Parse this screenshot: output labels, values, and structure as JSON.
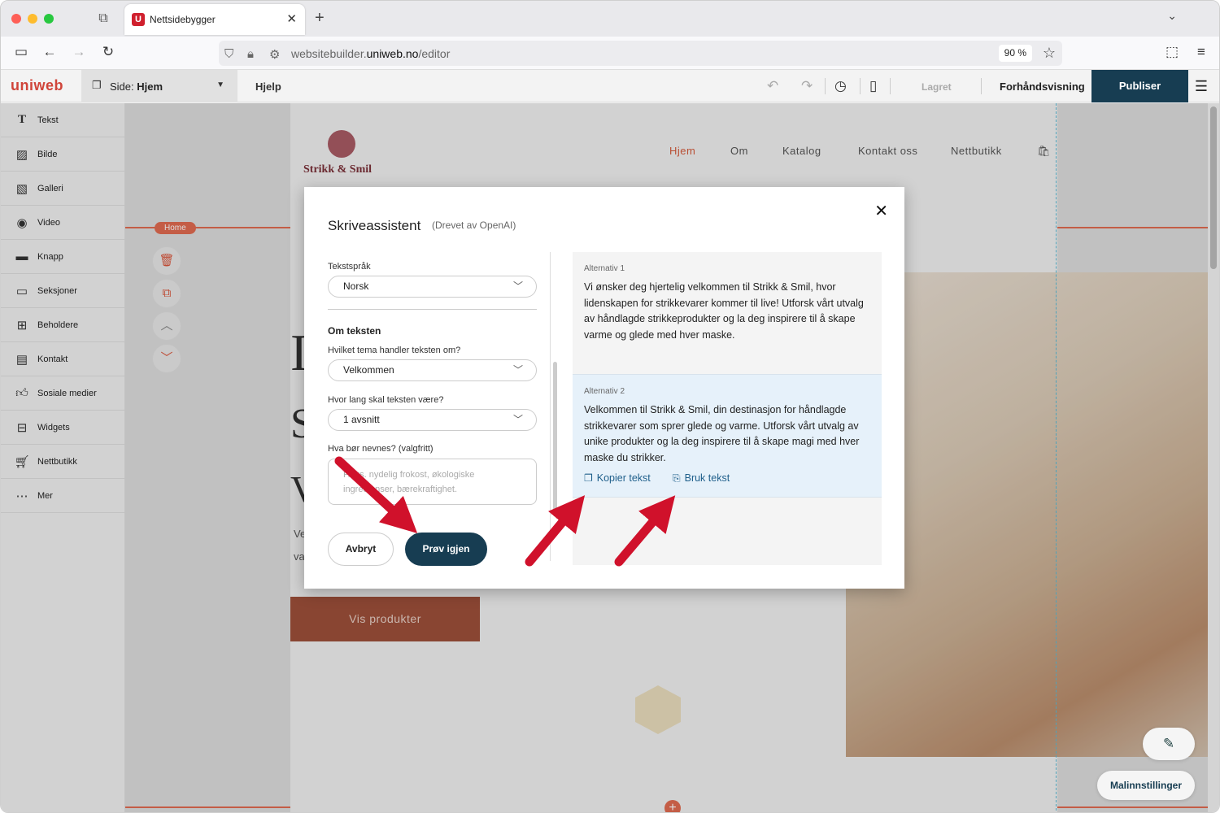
{
  "browser": {
    "tab_title": "Nettsidebygger",
    "tab_favicon": "U",
    "url_prefix": "websitebuilder.",
    "url_domain": "uniweb.no",
    "url_path": "/editor",
    "zoom": "90 %"
  },
  "app": {
    "logo": "uniweb",
    "page_selector_prefix": "Side: ",
    "page_selector_value": "Hjem",
    "help": "Hjelp",
    "status": "Lagret",
    "preview": "Forhåndsvisning",
    "publish": "Publiser"
  },
  "sidebar": {
    "items": [
      {
        "label": "Tekst",
        "icon": "text-icon"
      },
      {
        "label": "Bilde",
        "icon": "image-icon"
      },
      {
        "label": "Galleri",
        "icon": "gallery-icon"
      },
      {
        "label": "Video",
        "icon": "video-icon"
      },
      {
        "label": "Knapp",
        "icon": "button-icon"
      },
      {
        "label": "Seksjoner",
        "icon": "sections-icon"
      },
      {
        "label": "Beholdere",
        "icon": "containers-icon"
      },
      {
        "label": "Kontakt",
        "icon": "contact-icon"
      },
      {
        "label": "Sosiale medier",
        "icon": "thumbs-up-icon"
      },
      {
        "label": "Widgets",
        "icon": "widgets-icon"
      },
      {
        "label": "Nettbutikk",
        "icon": "cart-icon"
      },
      {
        "label": "Mer",
        "icon": "more-icon"
      }
    ]
  },
  "site": {
    "logo_text": "Strikk & Smil",
    "nav": [
      "Hjem",
      "Om",
      "Katalog",
      "Kontakt oss",
      "Nettbutikk"
    ],
    "home_tag": "Home",
    "cta": "Vis produkter",
    "partial_text_1": "Ve",
    "partial_text_2": "va"
  },
  "modal": {
    "title": "Skriveassistent",
    "subtitle": "(Drevet av OpenAI)",
    "language_label": "Tekstspråk",
    "language_value": "Norsk",
    "section_heading": "Om teksten",
    "theme_label": "Hvilket tema handler teksten om?",
    "theme_value": "Velkommen",
    "length_label": "Hvor lang skal teksten være?",
    "length_value": "1 avsnitt",
    "mention_label": "Hva bør nevnes? (valgfritt)",
    "mention_placeholder": "F.eks. nydelig frokost, økologiske ingredienser, bærekraftighet.",
    "cancel": "Avbryt",
    "retry": "Prøv igjen",
    "alternatives": [
      {
        "label": "Alternativ 1",
        "text": "Vi ønsker deg hjertelig velkommen til Strikk & Smil, hvor lidenskapen for strikkevarer kommer til live! Utforsk vårt utvalg av håndlagde strikkeprodukter og la deg inspirere til å skape varme og glede med hver maske."
      },
      {
        "label": "Alternativ 2",
        "text": "Velkommen til Strikk & Smil, din destinasjon for håndlagde strikkevarer som sprer glede og varme. Utforsk vårt utvalg av unike produkter og la deg inspirere til å skape magi med hver maske du strikker."
      }
    ],
    "copy_action": "Kopier tekst",
    "use_action": "Bruk tekst"
  },
  "bottom": {
    "template_settings": "Malinnstillinger"
  },
  "colors": {
    "accent": "#e06a50",
    "primary": "#173d52",
    "arrow": "#d0112b"
  }
}
